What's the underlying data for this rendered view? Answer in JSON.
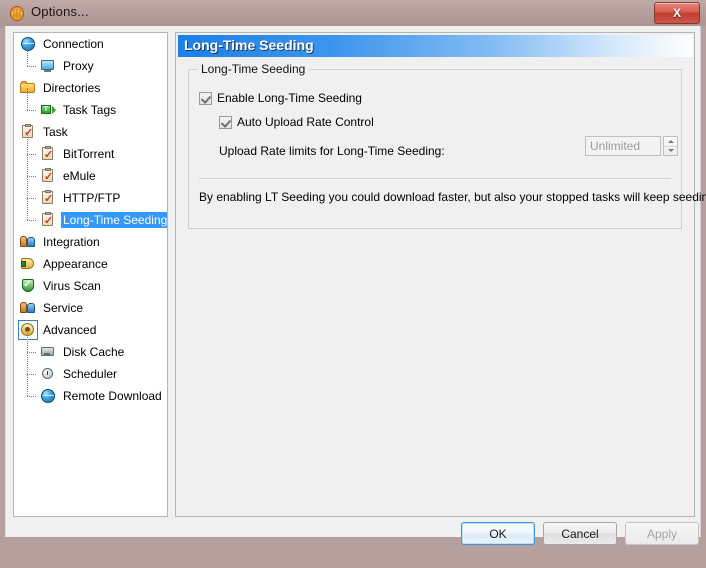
{
  "window": {
    "title": "Options...",
    "title_icon": "app-orange-icon",
    "close_label": "X"
  },
  "sidebar": {
    "items": [
      {
        "label": "Connection",
        "level": 0,
        "icon": "globe-icon",
        "selected": false
      },
      {
        "label": "Proxy",
        "level": 1,
        "icon": "monitor-icon",
        "selected": false
      },
      {
        "label": "Directories",
        "level": 0,
        "icon": "folder-icon",
        "selected": false
      },
      {
        "label": "Task Tags",
        "level": 1,
        "icon": "tag-icon",
        "selected": false
      },
      {
        "label": "Task",
        "level": 0,
        "icon": "clipboard-icon",
        "selected": false
      },
      {
        "label": "BitTorrent",
        "level": 1,
        "icon": "clipboard-icon",
        "selected": false
      },
      {
        "label": "eMule",
        "level": 1,
        "icon": "clipboard-icon",
        "selected": false
      },
      {
        "label": "HTTP/FTP",
        "level": 1,
        "icon": "clipboard-icon",
        "selected": false
      },
      {
        "label": "Long-Time Seeding",
        "level": 1,
        "icon": "clipboard-icon",
        "selected": true
      },
      {
        "label": "Integration",
        "level": 0,
        "icon": "people-icon",
        "selected": false
      },
      {
        "label": "Appearance",
        "level": 0,
        "icon": "brush-icon",
        "selected": false
      },
      {
        "label": "Virus Scan",
        "level": 0,
        "icon": "shield-icon",
        "selected": false
      },
      {
        "label": "Service",
        "level": 0,
        "icon": "people-icon",
        "selected": false
      },
      {
        "label": "Advanced",
        "level": 0,
        "icon": "advanced-icon",
        "selected": false,
        "focused": true
      },
      {
        "label": "Disk Cache",
        "level": 1,
        "icon": "disk-icon",
        "selected": false
      },
      {
        "label": "Scheduler",
        "level": 1,
        "icon": "clock-icon",
        "selected": false
      },
      {
        "label": "Remote Download",
        "level": 1,
        "icon": "globe-icon",
        "selected": false
      }
    ]
  },
  "main": {
    "page_title": "Long-Time Seeding",
    "groupbox_legend": "Long-Time Seeding",
    "checkbox_enable": {
      "label": "Enable Long-Time Seeding",
      "checked": true
    },
    "checkbox_auto": {
      "label": "Auto Upload Rate Control",
      "checked": true
    },
    "rate_label": "Upload Rate limits for Long-Time Seeding:",
    "rate_input_value": "Unlimited",
    "rate_input_placeholder": "Unlimited",
    "hint": "By enabling LT Seeding you could download faster, but also your stopped tasks will keep seeding."
  },
  "buttons": {
    "ok": "OK",
    "cancel": "Cancel",
    "apply": "Apply"
  },
  "colors": {
    "titlebar": "#b49d9b",
    "accent_blue": "#1c7fe8",
    "selection_blue": "#3399ff",
    "panel_bg": "#f0f0f0",
    "close_red": "#bf3f32"
  }
}
